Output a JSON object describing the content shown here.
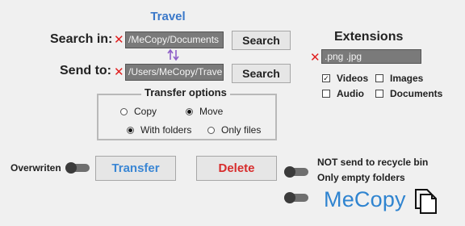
{
  "app": {
    "title": "Travel"
  },
  "search": {
    "label": "Search in:",
    "path": "/MeCopy/Documents",
    "button": "Search"
  },
  "send": {
    "label": "Send to:",
    "path": "/Users/MeCopy/Travel",
    "button": "Search"
  },
  "swap_icon": "swap-vertical-icon",
  "transfer_options": {
    "title": "Transfer options",
    "mode": [
      {
        "label": "Copy",
        "selected": false
      },
      {
        "label": "Move",
        "selected": true
      }
    ],
    "scope": [
      {
        "label": "With folders",
        "selected": true
      },
      {
        "label": "Only files",
        "selected": false
      }
    ]
  },
  "extensions": {
    "title": "Extensions",
    "value": ".png .jpg",
    "types": [
      {
        "label": "Videos",
        "checked": true
      },
      {
        "label": "Images",
        "checked": false
      },
      {
        "label": "Audio",
        "checked": false
      },
      {
        "label": "Documents",
        "checked": false
      }
    ]
  },
  "toggles": {
    "overwriten": {
      "label": "Overwriten",
      "on": false
    },
    "not_recycle": {
      "label": "NOT send to recycle bin",
      "on": false
    },
    "only_empty": {
      "label": "Only empty folders",
      "on": false
    }
  },
  "actions": {
    "transfer": "Transfer",
    "delete": "Delete"
  },
  "brand": {
    "name": "MeCopy",
    "icon": "copy-documents-icon"
  },
  "colors": {
    "title_blue": "#3a78c9",
    "transfer_blue": "#3a86d4",
    "delete_red": "#d72c2c",
    "error_x": "#e02020",
    "field_gray": "#7a7a7a"
  }
}
